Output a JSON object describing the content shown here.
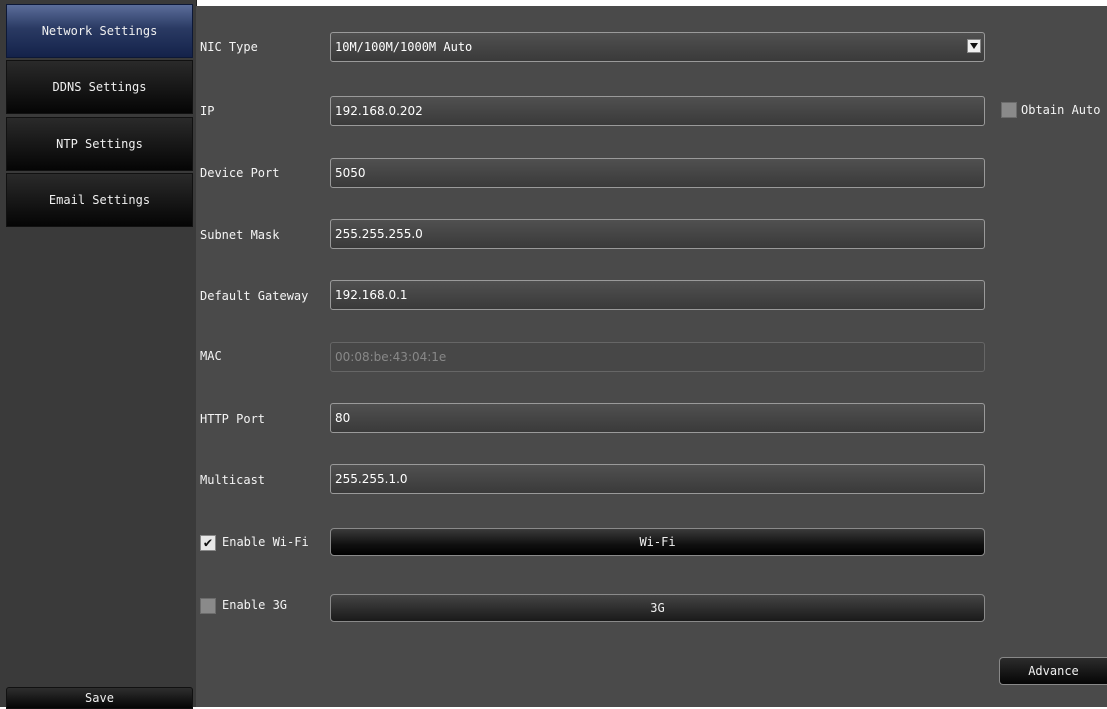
{
  "sidebar": {
    "items": [
      {
        "label": "Network Settings",
        "active": true
      },
      {
        "label": "DDNS Settings",
        "active": false
      },
      {
        "label": "NTP Settings",
        "active": false
      },
      {
        "label": "Email Settings",
        "active": false
      }
    ],
    "save_label": "Save"
  },
  "form": {
    "nic_type": {
      "label": "NIC Type",
      "value": "10M/100M/1000M Auto"
    },
    "ip": {
      "label": "IP",
      "value": "192.168.0.202"
    },
    "obtain_auto": {
      "label": "Obtain Auto",
      "checked": false
    },
    "device_port": {
      "label": "Device Port",
      "value": "5050"
    },
    "subnet_mask": {
      "label": "Subnet Mask",
      "value": "255.255.255.0"
    },
    "default_gateway": {
      "label": "Default Gateway",
      "value": "192.168.0.1"
    },
    "mac": {
      "label": "MAC",
      "value": "00:08:be:43:04:1e"
    },
    "http_port": {
      "label": "HTTP Port",
      "value": "80"
    },
    "multicast": {
      "label": "Multicast",
      "value": "255.255.1.0"
    },
    "enable_wifi": {
      "label": "Enable Wi-Fi",
      "checked": true
    },
    "wifi_button": "Wi-Fi",
    "enable_3g": {
      "label": "Enable 3G",
      "checked": false
    },
    "g3_button": "3G",
    "advance_label": "Advance"
  },
  "icons": {
    "dropdown": "chevron-down-icon",
    "check": "checkmark-icon"
  },
  "colors": {
    "background": "#4a4a4a",
    "sidebar": "#3a3a3a",
    "active_tab": "#2a3a63"
  }
}
